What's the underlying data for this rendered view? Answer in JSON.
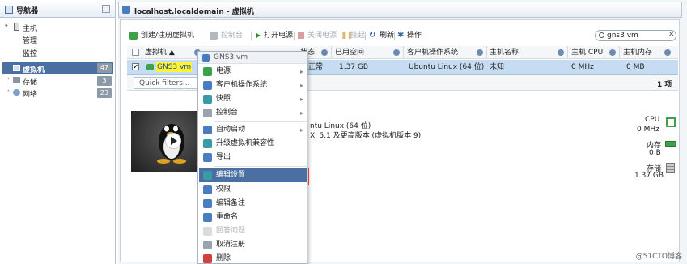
{
  "nav": {
    "title": "导航器",
    "host": "主机",
    "manage": "管理",
    "monitor": "监控",
    "vms": "虚拟机",
    "vms_count": "47",
    "storage": "存储",
    "storage_count": "3",
    "network": "网络",
    "network_count": "23"
  },
  "main": {
    "breadcrumb": "localhost.localdomain - 虚拟机",
    "toolbar": {
      "create": "创建/注册虚拟机",
      "console": "控制台",
      "power_on": "打开电源",
      "power_off": "关闭电源",
      "suspend": "挂起",
      "refresh": "刷新",
      "actions": "操作"
    },
    "search_value": "gns3 vm",
    "columns": [
      "虚拟机 ▲",
      "状态",
      "已用空间",
      "客户机操作系统",
      "主机名称",
      "主机 CPU",
      "主机内存"
    ],
    "row": {
      "name": "GNS3 vm",
      "status": "正常",
      "used": "1.37 GB",
      "os": "Ubuntu Linux (64 位)",
      "hostname": "未知",
      "cpu": "0 MHz",
      "mem": "0 MB"
    },
    "filter_placeholder": "Quick filters...",
    "count": "1 项"
  },
  "details": {
    "os": "ntu Linux (64 位)",
    "compat": "Xi 5.1 及更高版本 (虚拟机版本 9)",
    "cpu_label": "CPU",
    "cpu_value": "0 MHz",
    "mem_label": "内存",
    "mem_value": "0 B",
    "storage_label": "存储",
    "storage_value": "1.37 GB"
  },
  "menu": {
    "title": "GNS3 vm",
    "items": [
      "电源",
      "客户机操作系统",
      "快照",
      "控制台",
      "自动启动",
      "升级虚拟机兼容性",
      "导出",
      "编辑设置",
      "权限",
      "编辑备注",
      "重命名",
      "回答问题",
      "取消注册",
      "删除"
    ]
  },
  "watermark": "@51CTO博客"
}
